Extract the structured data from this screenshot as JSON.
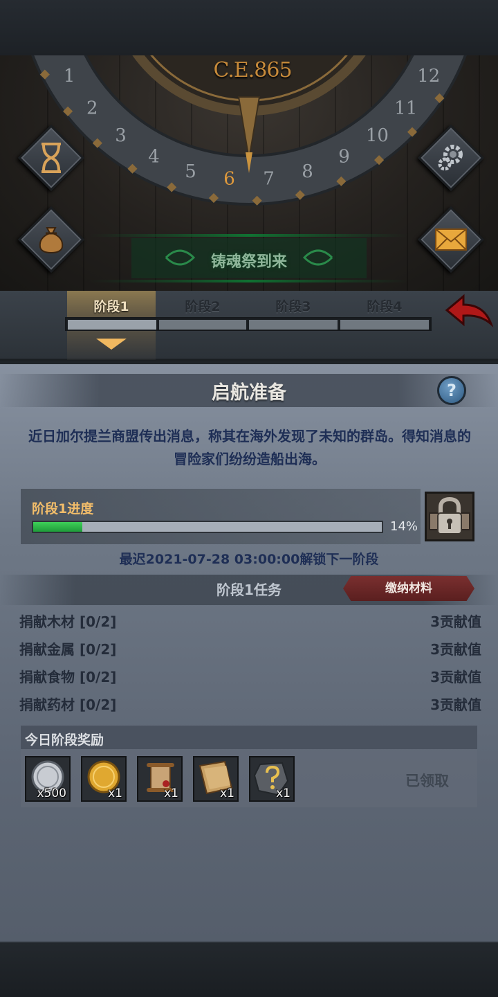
{
  "header": {
    "year": "C.E.865",
    "dial_numbers": [
      "1",
      "2",
      "3",
      "4",
      "5",
      "6",
      "7",
      "8",
      "9",
      "10",
      "11",
      "12"
    ],
    "current_month": "6",
    "event_banner": "铸魂祭到来",
    "icons": {
      "left_top": "hourglass-icon",
      "left_bottom": "money-bag-icon",
      "right_top": "gear-icon",
      "right_bottom": "mail-icon"
    }
  },
  "stages": {
    "tabs": [
      "阶段1",
      "阶段2",
      "阶段3",
      "阶段4"
    ],
    "active_index": 0
  },
  "panel": {
    "title": "启航准备",
    "help": "?",
    "description": "近日加尔提兰商盟传出消息，称其在海外发现了未知的群岛。得知消息的冒险家们纷纷造船出海。",
    "progress": {
      "label": "阶段1进度",
      "value": 0.14,
      "percent_text": "14%"
    },
    "unlock_text": "最迟2021-07-28 03:00:00解锁下一阶段",
    "tasks_title": "阶段1任务",
    "submit_button": "缴纳材料",
    "tasks": [
      {
        "name": "捐献木材 [0/2]",
        "reward": "3贡献值"
      },
      {
        "name": "捐献金属 [0/2]",
        "reward": "3贡献值"
      },
      {
        "name": "捐献食物 [0/2]",
        "reward": "3贡献值"
      },
      {
        "name": "捐献药材 [0/2]",
        "reward": "3贡献值"
      }
    ],
    "rewards": {
      "label": "今日阶段奖励",
      "items": [
        {
          "icon": "silver-coin-icon",
          "qty": "x500"
        },
        {
          "icon": "gold-coin-icon",
          "qty": "x1"
        },
        {
          "icon": "scroll-icon",
          "qty": "x1"
        },
        {
          "icon": "parchment-icon",
          "qty": "x1"
        },
        {
          "icon": "mystery-item-icon",
          "qty": "x1"
        }
      ],
      "status": "已领取"
    }
  },
  "colors": {
    "accent_gold": "#f2bd6a",
    "progress_green": "#2fbf4b",
    "submit_red": "#6a2626",
    "description_blue": "#1e2e55"
  }
}
